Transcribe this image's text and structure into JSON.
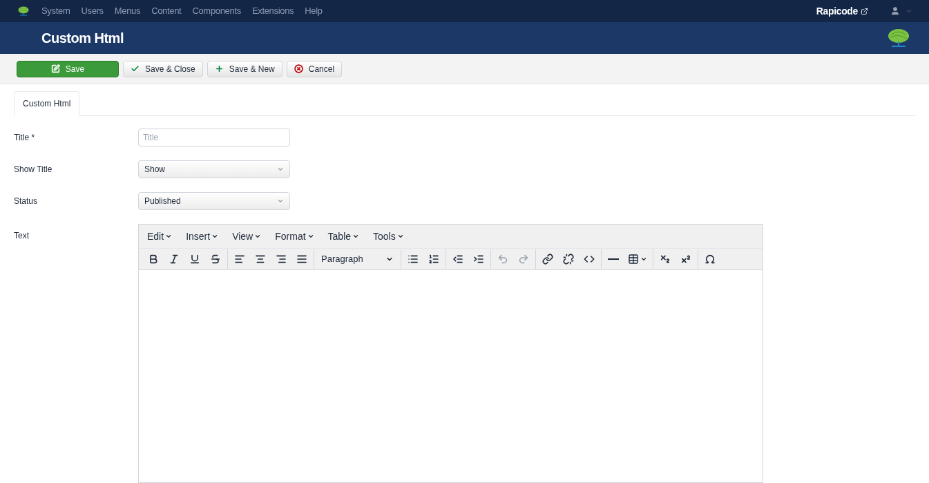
{
  "navbar": {
    "menu": [
      "System",
      "Users",
      "Menus",
      "Content",
      "Components",
      "Extensions",
      "Help"
    ],
    "site_link": "Rapicode"
  },
  "header": {
    "title": "Custom Html"
  },
  "toolbar": [
    {
      "kind": "save",
      "label": "Save"
    },
    {
      "kind": "check",
      "label": "Save & Close"
    },
    {
      "kind": "plus",
      "label": "Save & New"
    },
    {
      "kind": "cancel",
      "label": "Cancel"
    }
  ],
  "tabs": [
    {
      "label": "Custom Html",
      "selected": true
    }
  ],
  "fields": [
    {
      "kind": "text",
      "label": "Title *",
      "placeholder": "Title"
    },
    {
      "kind": "select",
      "label": "Show Title",
      "value": "Show"
    },
    {
      "kind": "select",
      "label": "Status",
      "value": "Published"
    }
  ],
  "editor": {
    "label": "Text",
    "menus": [
      "Edit",
      "Insert",
      "View",
      "Format",
      "Table",
      "Tools"
    ],
    "format_select": "Paragraph",
    "groups": [
      [
        {
          "kind": "bold",
          "disabled": false
        },
        {
          "kind": "italic",
          "disabled": false
        },
        {
          "kind": "underline",
          "disabled": false
        },
        {
          "kind": "strike",
          "disabled": false
        }
      ],
      [
        {
          "kind": "alignleft",
          "disabled": false
        },
        {
          "kind": "aligncenter",
          "disabled": false
        },
        {
          "kind": "alignright",
          "disabled": false
        },
        {
          "kind": "justify",
          "disabled": false
        }
      ],
      [
        {
          "kind": "format"
        }
      ],
      [
        {
          "kind": "bullets",
          "disabled": false
        },
        {
          "kind": "numbers",
          "disabled": false
        }
      ],
      [
        {
          "kind": "outdent",
          "disabled": false
        },
        {
          "kind": "indent",
          "disabled": false
        }
      ],
      [
        {
          "kind": "undo",
          "disabled": true
        },
        {
          "kind": "redo",
          "disabled": true
        }
      ],
      [
        {
          "kind": "link",
          "disabled": false
        },
        {
          "kind": "unlink",
          "disabled": false
        },
        {
          "kind": "code",
          "disabled": false
        }
      ],
      [
        {
          "kind": "hr",
          "disabled": false
        },
        {
          "kind": "table",
          "disabled": false
        }
      ],
      [
        {
          "kind": "subscript",
          "disabled": false
        },
        {
          "kind": "superscript",
          "disabled": false
        }
      ],
      [
        {
          "kind": "omega",
          "disabled": false
        }
      ]
    ]
  }
}
